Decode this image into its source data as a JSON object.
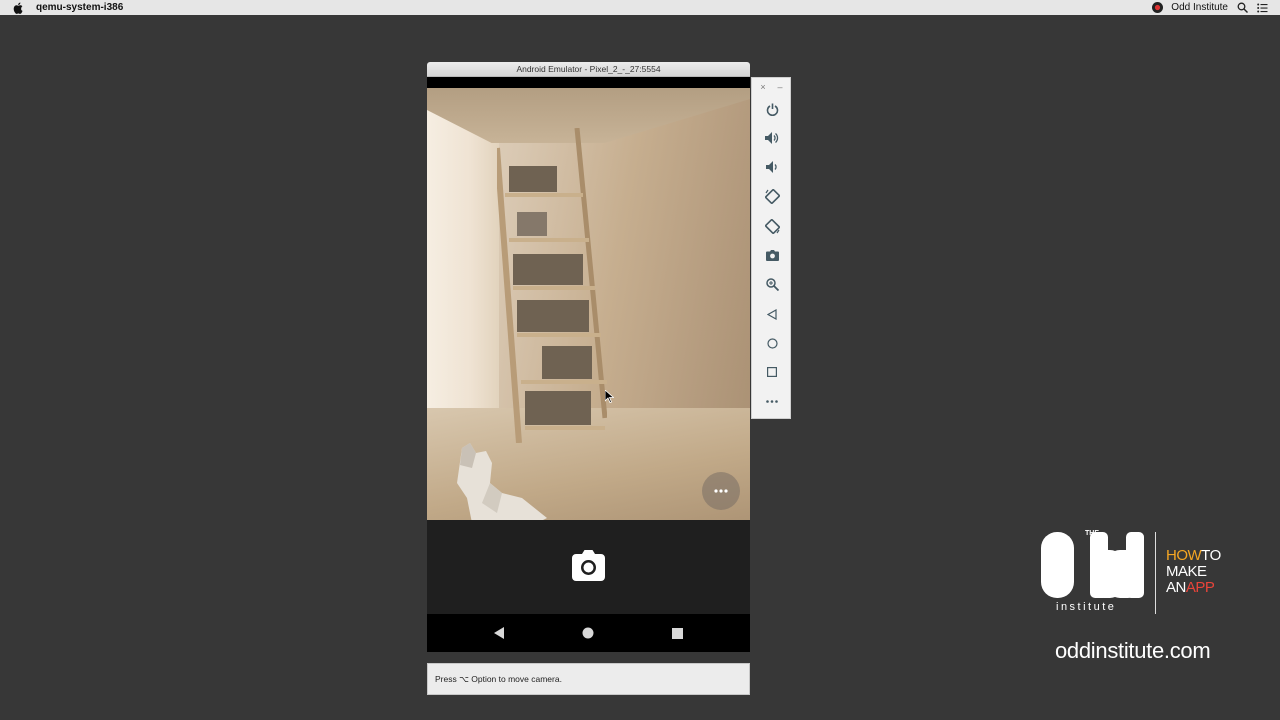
{
  "menubar": {
    "app_name": "qemu-system-i386",
    "user_name": "Odd Institute"
  },
  "emulator": {
    "window_title": "Android Emulator - Pixel_2_-_27:5554",
    "hint_text": "Press ⌥ Option to move camera."
  },
  "toolbar": {
    "close_label": "×",
    "minimize_label": "–",
    "buttons": [
      "power-icon",
      "volume-up-icon",
      "volume-down-icon",
      "rotate-left-icon",
      "rotate-right-icon",
      "screenshot-icon",
      "zoom-icon",
      "back-icon",
      "home-icon",
      "overview-icon",
      "more-icon"
    ]
  },
  "branding": {
    "the": "THE",
    "institute": "institute",
    "how": "HOW",
    "to": "TO",
    "make": "MAKE",
    "an": "AN",
    "app": "APP",
    "url": "oddinstitute.com"
  },
  "colors": {
    "desktop": "#373737",
    "brand_orange": "#f5a623",
    "brand_red": "#e8443a"
  }
}
